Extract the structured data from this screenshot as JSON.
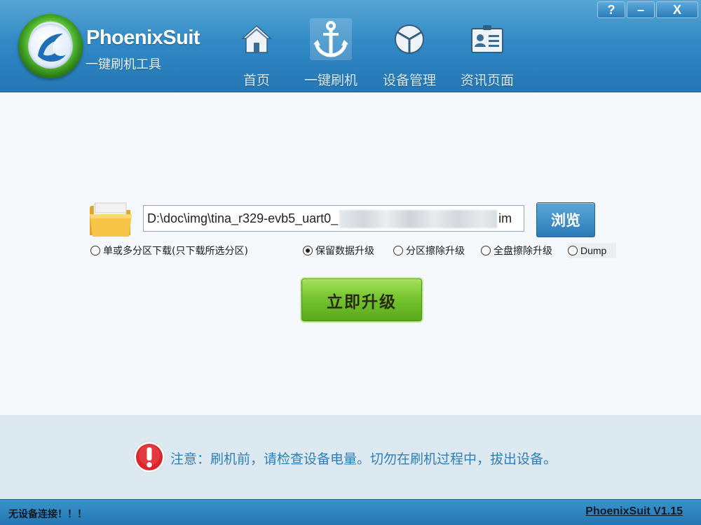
{
  "app": {
    "brand": "PhoenixSuit",
    "subtitle": "一键刷机工具"
  },
  "window_controls": {
    "help": "?",
    "minimize": "–",
    "close": "X"
  },
  "nav": {
    "items": [
      {
        "label": "首页",
        "icon": "home-icon",
        "active": false
      },
      {
        "label": "一键刷机",
        "icon": "anchor-icon",
        "active": true
      },
      {
        "label": "设备管理",
        "icon": "device-cube-icon",
        "active": false
      },
      {
        "label": "资讯页面",
        "icon": "news-card-icon",
        "active": false
      }
    ]
  },
  "flash": {
    "path_visible_start": "D:\\doc\\img\\tina_r329-evb5_uart0_",
    "path_visible_end": "im",
    "browse_label": "浏览",
    "options": {
      "partition_download": {
        "label": "单或多分区下载(只下载所选分区)",
        "checked": false
      },
      "keep_data": {
        "label": "保留数据升级",
        "checked": true
      },
      "partition_erase": {
        "label": "分区擦除升级",
        "checked": false
      },
      "full_erase": {
        "label": "全盘擦除升级",
        "checked": false
      },
      "dump": {
        "label": "Dump",
        "checked": false
      }
    },
    "upgrade_label": "立即升级"
  },
  "notice": {
    "text": "注意：刷机前，请检查设备电量。切勿在刷机过程中，拔出设备。"
  },
  "status": {
    "connection": "无设备连接！！！",
    "version": "PhoenixSuit V1.15"
  },
  "colors": {
    "header_blue": "#2e86c2",
    "button_blue": "#2b7bb8",
    "upgrade_green": "#77c431",
    "notice_text": "#2e7fb9",
    "notice_bg": "#dde9f0"
  }
}
